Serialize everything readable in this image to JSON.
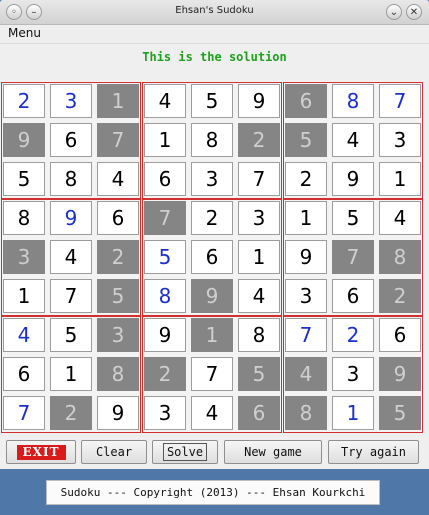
{
  "window": {
    "title": "Ehsan's Sudoku",
    "minimize_glyph": "–",
    "maximize_glyph": "⌄",
    "close_glyph": "✕"
  },
  "menu": {
    "label": "Menu"
  },
  "status": {
    "text": "This is the solution"
  },
  "board": {
    "rows": [
      [
        2,
        3,
        1,
        4,
        5,
        9,
        6,
        8,
        7
      ],
      [
        9,
        6,
        7,
        1,
        8,
        2,
        5,
        4,
        3
      ],
      [
        5,
        8,
        4,
        6,
        3,
        7,
        2,
        9,
        1
      ],
      [
        8,
        9,
        6,
        7,
        2,
        3,
        1,
        5,
        4
      ],
      [
        3,
        4,
        2,
        5,
        6,
        1,
        9,
        7,
        8
      ],
      [
        1,
        7,
        5,
        8,
        9,
        4,
        3,
        6,
        2
      ],
      [
        4,
        5,
        3,
        9,
        1,
        8,
        7,
        2,
        6
      ],
      [
        6,
        1,
        8,
        2,
        7,
        5,
        4,
        3,
        9
      ],
      [
        7,
        2,
        9,
        3,
        4,
        6,
        8,
        1,
        5
      ]
    ],
    "cell_styles": [
      [
        "b",
        "b",
        "g",
        "k",
        "k",
        "k",
        "g",
        "b",
        "b"
      ],
      [
        "g",
        "k",
        "g",
        "k",
        "k",
        "g",
        "g",
        "k",
        "k"
      ],
      [
        "k",
        "k",
        "k",
        "k",
        "k",
        "k",
        "k",
        "k",
        "k"
      ],
      [
        "k",
        "b",
        "k",
        "g",
        "k",
        "k",
        "k",
        "k",
        "k"
      ],
      [
        "g",
        "k",
        "g",
        "b",
        "k",
        "k",
        "k",
        "g",
        "g"
      ],
      [
        "k",
        "k",
        "g",
        "b",
        "g",
        "k",
        "k",
        "k",
        "g"
      ],
      [
        "b",
        "k",
        "g",
        "k",
        "g",
        "k",
        "b",
        "b",
        "k"
      ],
      [
        "k",
        "k",
        "g",
        "g",
        "k",
        "g",
        "g",
        "k",
        "g"
      ],
      [
        "b",
        "g",
        "k",
        "k",
        "k",
        "g",
        "g",
        "b",
        "g"
      ]
    ],
    "colors": {
      "given": "#000000",
      "solved": "#1a2fd0",
      "shaded_bg": "#858585",
      "shaded_text": "#cfcfcf",
      "box_border": "#d23030"
    }
  },
  "buttons": {
    "exit": "EXIT",
    "clear": "Clear",
    "solve": "Solve",
    "new_game": "New game",
    "try_again": "Try again"
  },
  "footer": {
    "text": "Sudoku --- Copyright (2013) --- Ehsan Kourkchi"
  }
}
